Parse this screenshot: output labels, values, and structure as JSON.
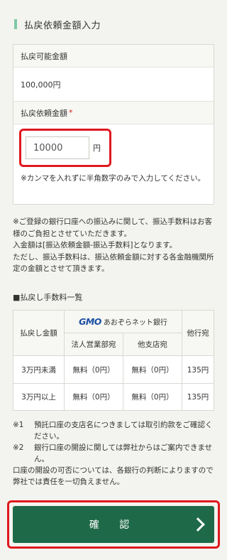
{
  "section_title": "払戻依頼金額入力",
  "form": {
    "available_label": "払戻可能金額",
    "available_value": "100,000円",
    "request_label": "払戻依頼金額",
    "required_mark": "*",
    "amount_value": "10000",
    "unit": "円",
    "hint": "※カンマを入れずに半角数字のみで入力してください。"
  },
  "notes": [
    "※ご登録の銀行口座への振込みに関して、振込手数料はお客様のご負担とさせていただきます。",
    "入金額は[振込依頼金額-振込手数料]となります。",
    "ただし、振込手数料は、振込依頼金額に対する各金融機関所定の金額とさせて頂きます。"
  ],
  "fee_title": "■払戻し手数料一覧",
  "fee_table": {
    "col_amount": "払戻し金額",
    "bank_logo": "GMO",
    "bank_name": "あおぞらネット銀行",
    "col_corporate": "法人営業部宛",
    "col_other_branch": "他支店宛",
    "col_other_bank": "他行宛",
    "rows": [
      {
        "amount": "3万円未満",
        "corporate": "無料（0円）",
        "branch": "無料（0円）",
        "other": "135円"
      },
      {
        "amount": "3万円以上",
        "corporate": "無料（0円）",
        "branch": "無料（0円）",
        "other": "135円"
      }
    ]
  },
  "footnotes": {
    "fn1_mark": "※1",
    "fn1_text": "預託口座の支店名につきましては取引約款をご確認ください。",
    "fn2_mark": "※2",
    "fn2_text": "銀行口座の開設に関しては弊社からはご案内できません。",
    "fn2_extra": "口座の開設の可否については、各銀行の判断によりますので弊社では責任を一切負えません。"
  },
  "confirm_label": "確 認",
  "colors": {
    "accent_green": "#1e6a48",
    "highlight_red": "#e0181f",
    "section_bar": "#7fc8a3"
  },
  "icons": {
    "confirm": "chevron-right-icon"
  }
}
